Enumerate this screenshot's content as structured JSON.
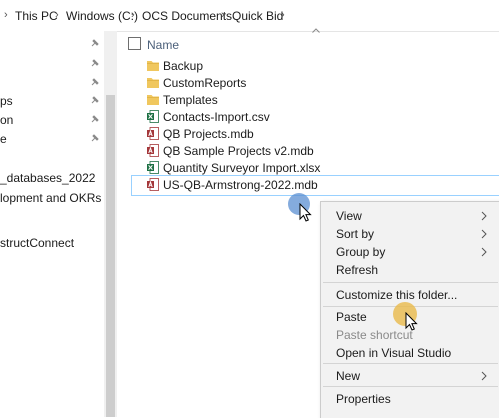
{
  "breadcrumb": {
    "items": [
      "This PC",
      "Windows (C:)",
      "OCS Documents",
      "Quick Bid"
    ]
  },
  "nav": {
    "items": [
      {
        "label": "ps",
        "pinned": true
      },
      {
        "label": "on",
        "pinned": true
      },
      {
        "label": "e",
        "pinned": true
      },
      {
        "label": "_databases_2022",
        "pinned": false
      },
      {
        "label": "lopment and OKRs",
        "pinned": false
      },
      {
        "label": "structConnect",
        "pinned": false
      }
    ]
  },
  "content": {
    "column_name": "Name",
    "files": [
      {
        "name": "Backup",
        "type": "folder",
        "icon": "folder-icon"
      },
      {
        "name": "CustomReports",
        "type": "folder",
        "icon": "folder-icon"
      },
      {
        "name": "Templates",
        "type": "folder",
        "icon": "folder-icon"
      },
      {
        "name": "Contacts-Import.csv",
        "type": "excel",
        "icon": "excel-icon"
      },
      {
        "name": "QB Projects.mdb",
        "type": "access",
        "icon": "access-db-icon"
      },
      {
        "name": "QB Sample Projects v2.mdb",
        "type": "access",
        "icon": "access-db-icon"
      },
      {
        "name": "Quantity Surveyor Import.xlsx",
        "type": "excel",
        "icon": "excel-icon"
      },
      {
        "name": "US-QB-Armstrong-2022.mdb",
        "type": "access",
        "icon": "access-db-icon",
        "selected": true
      }
    ]
  },
  "context_menu": {
    "items": [
      {
        "label": "View",
        "submenu": true
      },
      {
        "label": "Sort by",
        "submenu": true
      },
      {
        "label": "Group by",
        "submenu": true
      },
      {
        "label": "Refresh"
      },
      {
        "label": "Customize this folder..."
      },
      {
        "label": "Paste"
      },
      {
        "label": "Paste shortcut",
        "disabled": true
      },
      {
        "label": "Open in Visual Studio"
      },
      {
        "label": "New",
        "submenu": true
      },
      {
        "label": "Properties"
      }
    ]
  },
  "colors": {
    "folder": "#f0c75e",
    "excel": "#1d7044",
    "access": "#a4373a",
    "selection_border": "#99d1ff",
    "click_halo_blue": "#5b8fd1",
    "click_halo_yellow": "#e8b94a"
  }
}
